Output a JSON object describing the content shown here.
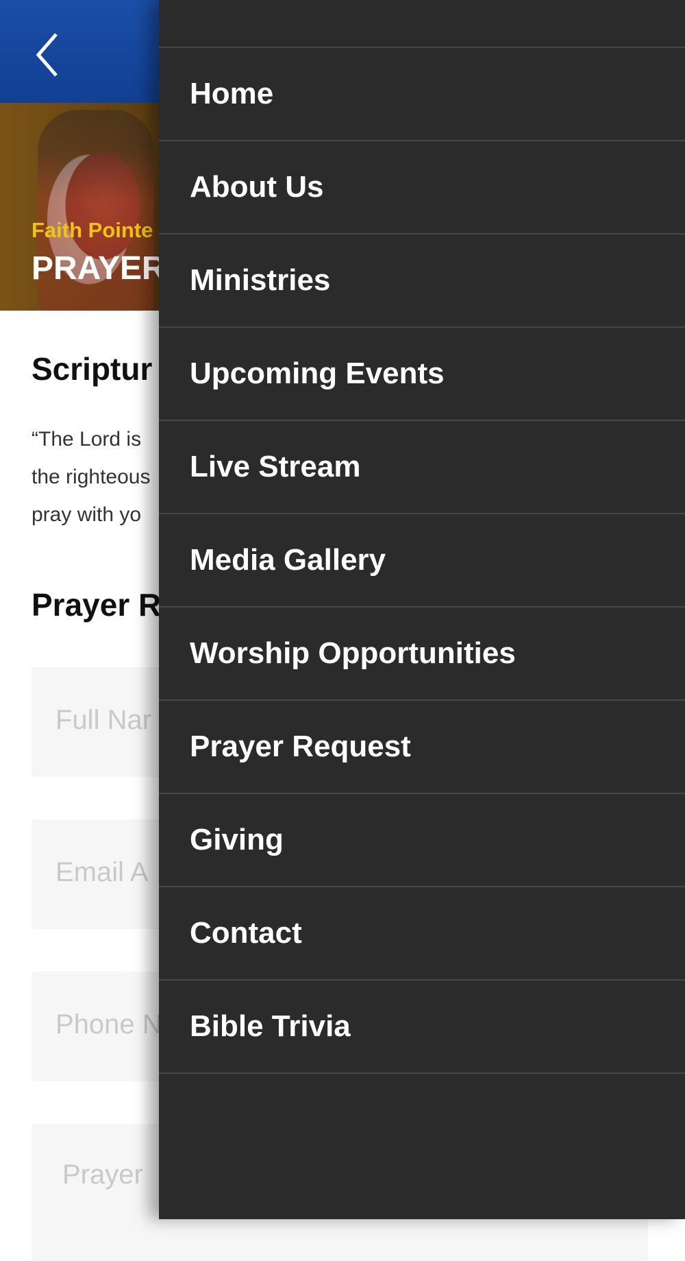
{
  "header": {
    "back_icon": "chevron-left-icon",
    "bar_color": "#1a4fa8"
  },
  "hero": {
    "subtitle": "Faith Pointe",
    "title": "PRAYER"
  },
  "scripture": {
    "heading": "Scriptur",
    "line1": "“The Lord is",
    "line2": "the righteous",
    "line3": "pray with yo"
  },
  "form": {
    "heading": "Prayer R",
    "fields": [
      {
        "placeholder": "Full Nar"
      },
      {
        "placeholder": "Email A"
      },
      {
        "placeholder": "Phone N"
      },
      {
        "placeholder": "Prayer"
      }
    ]
  },
  "drawer": {
    "background": "#2b2b2b",
    "items": [
      {
        "label": "Home"
      },
      {
        "label": "About Us"
      },
      {
        "label": "Ministries"
      },
      {
        "label": "Upcoming Events"
      },
      {
        "label": "Live Stream"
      },
      {
        "label": "Media Gallery"
      },
      {
        "label": "Worship Opportunities"
      },
      {
        "label": "Prayer Request"
      },
      {
        "label": "Giving"
      },
      {
        "label": "Contact"
      },
      {
        "label": "Bible Trivia"
      }
    ]
  }
}
